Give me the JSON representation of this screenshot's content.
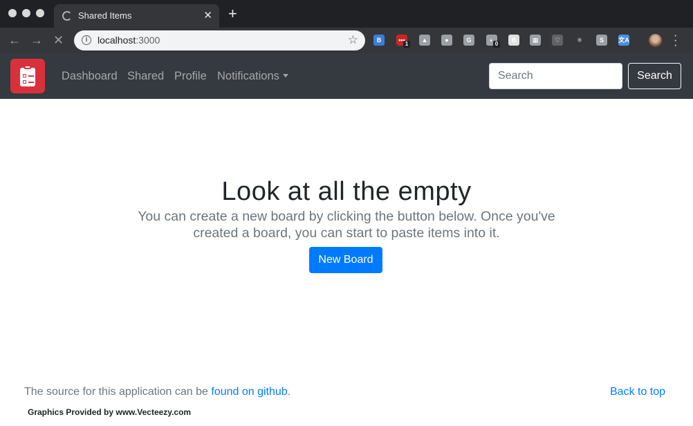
{
  "browser": {
    "tab_title": "Shared Items",
    "url_host": "localhost",
    "url_port": ":3000",
    "extensions": [
      {
        "name": "bootstrap-ext-icon",
        "label": "B",
        "color": "#3b7ddd"
      },
      {
        "name": "lastpass-ext-icon",
        "label": "•••",
        "color": "#c62828",
        "badge": "1"
      },
      {
        "name": "drive-ext-icon",
        "label": "▲",
        "color": "#9aa0a6"
      },
      {
        "name": "circle-ext-icon",
        "label": "●",
        "color": "#9aa0a6"
      },
      {
        "name": "grammarly-ext-icon",
        "label": "G",
        "color": "#9aa0a6"
      },
      {
        "name": "ghost-ext-icon",
        "label": "◐",
        "color": "#9aa0a6",
        "badge": "0"
      },
      {
        "name": "b-square-ext-icon",
        "label": "B",
        "color": "#e0e0e0"
      },
      {
        "name": "clipboard-ext-icon",
        "label": "▦",
        "color": "#9aa0a6"
      },
      {
        "name": "pocket-ext-icon",
        "label": "♡",
        "color": "#5f6368"
      },
      {
        "name": "react-ext-icon",
        "label": "⚛",
        "color": "#35363a"
      },
      {
        "name": "s-ext-icon",
        "label": "S",
        "color": "#9aa0a6"
      },
      {
        "name": "translate-ext-icon",
        "label": "文A",
        "color": "#4a90d9"
      }
    ]
  },
  "navbar": {
    "links": [
      "Dashboard",
      "Shared",
      "Profile",
      "Notifications"
    ],
    "search_placeholder": "Search",
    "search_button": "Search"
  },
  "hero": {
    "title": "Look at all the empty",
    "text": "You can create a new board by clicking the button below. Once you've created a board, you can start to paste items into it.",
    "button": "New Board"
  },
  "footer": {
    "prefix": "The source for this application can be ",
    "link": "found on github",
    "suffix": ".",
    "back_to_top": "Back to top",
    "credits": "Graphics Provided by www.Vecteezy.com"
  }
}
